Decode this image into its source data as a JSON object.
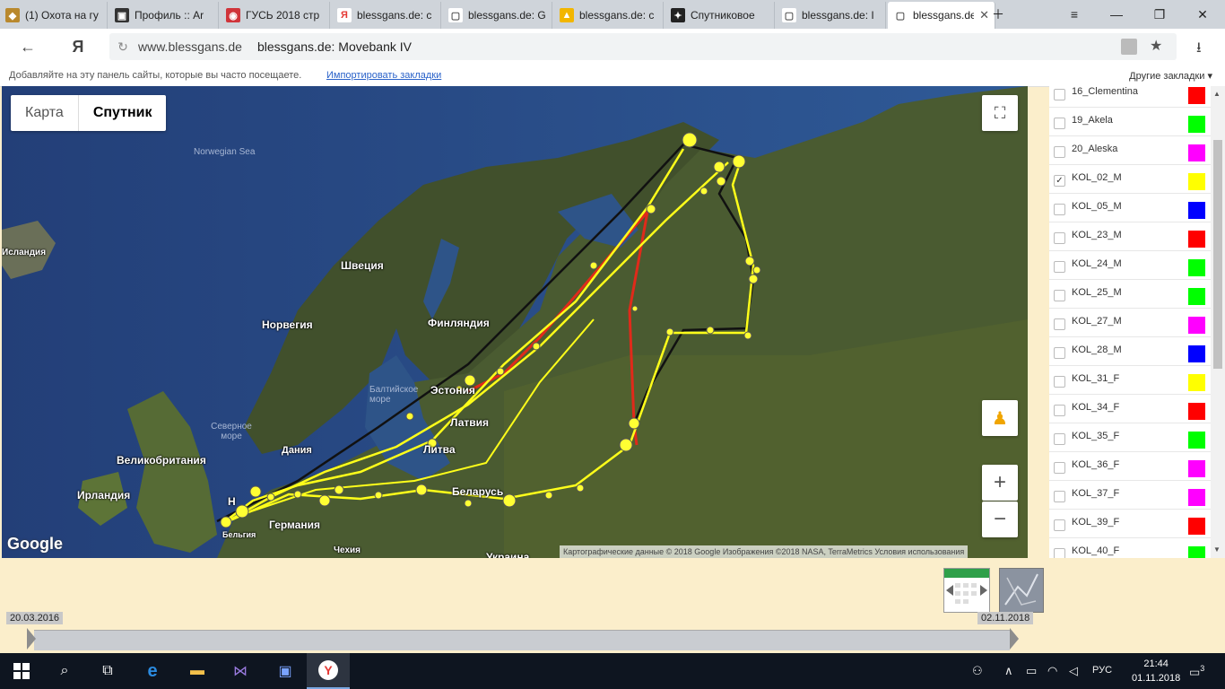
{
  "tabs": [
    {
      "icon": "fox-icon",
      "fav_bg": "#b9892e",
      "fav_glyph": "◆",
      "title": "(1) Охота на гу"
    },
    {
      "icon": "profile-icon",
      "fav_bg": "#333333",
      "fav_glyph": "▣",
      "title": "Профиль :: Ar"
    },
    {
      "icon": "goose-icon",
      "fav_bg": "#d0343a",
      "fav_glyph": "◉",
      "title": "ГУСЬ 2018 стр"
    },
    {
      "icon": "yandex-icon",
      "fav_bg": "#ffffff",
      "fav_glyph": "Я",
      "title": "blessgans.de: c"
    },
    {
      "icon": "page-icon",
      "fav_bg": "#ffffff",
      "fav_glyph": "▢",
      "title": "blessgans.de: G"
    },
    {
      "icon": "mountain-icon",
      "fav_bg": "#f2b600",
      "fav_glyph": "▲",
      "title": "blessgans.de: c"
    },
    {
      "icon": "satellite-icon",
      "fav_bg": "#222222",
      "fav_glyph": "✦",
      "title": "Спутниковое"
    },
    {
      "icon": "page-icon",
      "fav_bg": "#ffffff",
      "fav_glyph": "▢",
      "title": "blessgans.de: I"
    },
    {
      "icon": "page-icon",
      "fav_bg": "#ffffff",
      "fav_glyph": "▢",
      "title": "blessgans.de"
    }
  ],
  "address": {
    "domain": "www.blessgans.de",
    "title": "blessgans.de: Movebank IV"
  },
  "bookmarks": {
    "hint": "Добавляйте на эту панель сайты, которые вы часто посещаете.",
    "import_link": "Импортировать закладки",
    "other": "Другие закладки"
  },
  "map": {
    "map_button": "Карта",
    "satellite_button": "Спутник",
    "labels": {
      "sweden": "Швеция",
      "norway": "Норвегия",
      "finland": "Финляндия",
      "uk": "Великобритания",
      "ireland": "Ирландия",
      "denmark": "Дания",
      "germany": "Германия",
      "belarus": "Беларусь",
      "lithuania": "Литва",
      "latvia": "Латвия",
      "estonia": "Эстония",
      "baltic": "Балтийское море",
      "northsea": "Северное море",
      "norwegian_sea": "Norwegian Sea",
      "iceland": "Исландия",
      "belgium": "Бельгия",
      "czech": "Чехия",
      "ukraine": "Украина",
      "netherlands": "Н"
    },
    "logo": "Google",
    "attribution": "Картографические данные © 2018 Google Изображения ©2018 NASA, TerraMetrics   Условия использования"
  },
  "birds": [
    {
      "name": "16_Clementina",
      "color": "#ff0000",
      "checked": false
    },
    {
      "name": "19_Akela",
      "color": "#00ff00",
      "checked": false
    },
    {
      "name": "20_Aleska",
      "color": "#ff00ff",
      "checked": false
    },
    {
      "name": "KOL_02_M",
      "color": "#ffff00",
      "checked": true
    },
    {
      "name": "KOL_05_M",
      "color": "#0000ff",
      "checked": false
    },
    {
      "name": "KOL_23_M",
      "color": "#ff0000",
      "checked": false
    },
    {
      "name": "KOL_24_M",
      "color": "#00ff00",
      "checked": false
    },
    {
      "name": "KOL_25_M",
      "color": "#00ff00",
      "checked": false
    },
    {
      "name": "KOL_27_M",
      "color": "#ff00ff",
      "checked": false
    },
    {
      "name": "KOL_28_M",
      "color": "#0000ff",
      "checked": false
    },
    {
      "name": "KOL_31_F",
      "color": "#ffff00",
      "checked": false
    },
    {
      "name": "KOL_34_F",
      "color": "#ff0000",
      "checked": false
    },
    {
      "name": "KOL_35_F",
      "color": "#00ff00",
      "checked": false
    },
    {
      "name": "KOL_36_F",
      "color": "#ff00ff",
      "checked": false
    },
    {
      "name": "KOL_37_F",
      "color": "#ff00ff",
      "checked": false
    },
    {
      "name": "KOL_39_F",
      "color": "#ff0000",
      "checked": false
    },
    {
      "name": "KOL_40_F",
      "color": "#00ff00",
      "checked": false
    }
  ],
  "timeline": {
    "start": "20.03.2016",
    "end": "02.11.2018"
  },
  "taskbar": {
    "lang": "РУС",
    "time": "21:44",
    "date": "01.11.2018",
    "notifications": "3"
  }
}
